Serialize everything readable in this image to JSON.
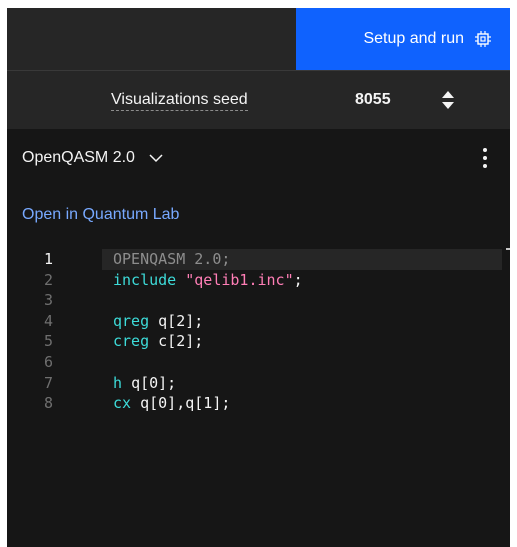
{
  "toolbar": {
    "run_label": "Setup and run",
    "run_icon": "chip-icon",
    "accent": "#0f62fe"
  },
  "seed": {
    "label": "Visualizations seed",
    "value": "8055"
  },
  "editor_header": {
    "language": "OpenQASM 2.0",
    "open_lab_link": "Open in Quantum Lab"
  },
  "code": {
    "lines": [
      {
        "n": "1",
        "tokens": [
          {
            "t": "OPENQASM 2.0;",
            "c": "comment"
          }
        ]
      },
      {
        "n": "2",
        "tokens": [
          {
            "t": "include ",
            "c": "kw"
          },
          {
            "t": "\"qelib1.inc\"",
            "c": "str"
          },
          {
            "t": ";",
            "c": "txt"
          }
        ]
      },
      {
        "n": "3",
        "tokens": []
      },
      {
        "n": "4",
        "tokens": [
          {
            "t": "qreg ",
            "c": "kw"
          },
          {
            "t": "q[2];",
            "c": "txt"
          }
        ]
      },
      {
        "n": "5",
        "tokens": [
          {
            "t": "creg ",
            "c": "kw"
          },
          {
            "t": "c[2];",
            "c": "txt"
          }
        ]
      },
      {
        "n": "6",
        "tokens": []
      },
      {
        "n": "7",
        "tokens": [
          {
            "t": "h ",
            "c": "kw"
          },
          {
            "t": "q[0];",
            "c": "txt"
          }
        ]
      },
      {
        "n": "8",
        "tokens": [
          {
            "t": "cx ",
            "c": "kw"
          },
          {
            "t": "q[0],q[1];",
            "c": "txt"
          }
        ]
      }
    ],
    "active_line": "1"
  }
}
